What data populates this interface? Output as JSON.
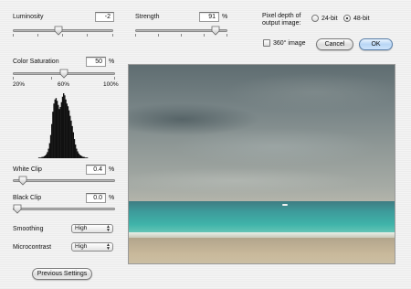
{
  "luminosity": {
    "label": "Luminosity",
    "value": "-2",
    "level": 0.45
  },
  "strength": {
    "label": "Strength",
    "value": "91",
    "unit": "%",
    "level": 0.91
  },
  "pixel_depth": {
    "label_line1": "Pixel depth of",
    "label_line2": "output image:",
    "options": [
      {
        "label": "24-bit",
        "selected": false
      },
      {
        "label": "48-bit",
        "selected": true
      }
    ]
  },
  "panorama": {
    "label": "360° image",
    "checked": false
  },
  "buttons": {
    "cancel": "Cancel",
    "ok": "OK",
    "previous_settings": "Previous Settings"
  },
  "color_saturation": {
    "label": "Color Saturation",
    "value": "50",
    "unit": "%",
    "level": 0.5,
    "scale": [
      "20%",
      "60%",
      "100%"
    ]
  },
  "white_clip": {
    "label": "White Clip",
    "value": "0.4",
    "unit": "%",
    "level": 0.06
  },
  "black_clip": {
    "label": "Black Clip",
    "value": "0.0",
    "unit": "%",
    "level": 0.0
  },
  "smoothing": {
    "label": "Smoothing",
    "value": "High"
  },
  "microcontrast": {
    "label": "Microcontrast",
    "value": "High"
  },
  "colors": {
    "default_button": "#b8d6f5",
    "histogram": "#111111"
  },
  "histogram": [
    0,
    0,
    0,
    0,
    0,
    1,
    1,
    1,
    2,
    2,
    3,
    4,
    6,
    9,
    14,
    22,
    34,
    50,
    68,
    80,
    86,
    88,
    84,
    78,
    72,
    75,
    82,
    90,
    95,
    92,
    86,
    80,
    76,
    70,
    62,
    55,
    47,
    38,
    28,
    20,
    14,
    10,
    7,
    5,
    4,
    3,
    2,
    2,
    1,
    1,
    1,
    0,
    0,
    0,
    0,
    0
  ]
}
